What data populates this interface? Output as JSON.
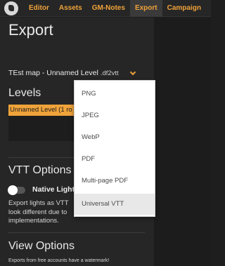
{
  "nav": {
    "items": [
      {
        "label": "Editor"
      },
      {
        "label": "Assets"
      },
      {
        "label": "GM-Notes"
      },
      {
        "label": "Export",
        "active": true
      },
      {
        "label": "Campaign"
      }
    ]
  },
  "panel": {
    "title": "Export",
    "map_select": {
      "value": "TEst map - Unnamed Level",
      "extension": ".df2vtt"
    },
    "levels": {
      "heading": "Levels",
      "items": [
        "Unnamed Level (1 ro"
      ]
    },
    "vtt_options": {
      "heading": "VTT Options",
      "toggle_label": "Native Light",
      "toggle_on": false,
      "description_lines": [
        "Export lights as VTT",
        "look different due to",
        "implementations."
      ]
    },
    "view_options": {
      "heading": "View Options",
      "note": "Exports from free accounts have a watermark!"
    }
  },
  "format_dropdown": {
    "options": [
      "PNG",
      "JPEG",
      "WebP",
      "PDF",
      "Multi-page PDF",
      "Universal VTT"
    ],
    "selected": "Universal VTT"
  },
  "colors": {
    "accent": "#f0a33a",
    "panel_bg": "#262626",
    "app_bg": "#1e1e1e",
    "dropdown_bg": "#ffffff",
    "dropdown_selected_bg": "#e8e8e8"
  }
}
